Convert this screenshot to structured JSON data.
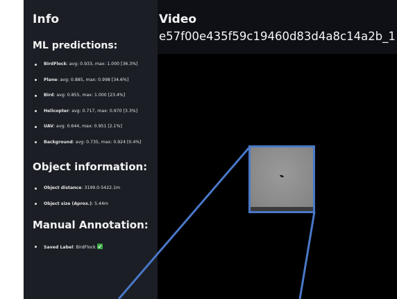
{
  "sidebar": {
    "title": "Info",
    "ml_section": {
      "title": "ML predictions:",
      "items": [
        {
          "name": "BirdFlock",
          "detail": ": avg: 0.933, max: 1.000 [36.3%]"
        },
        {
          "name": "Plane",
          "detail": ": avg: 0.885, max: 0.998 [34.6%]"
        },
        {
          "name": "Bird",
          "detail": ": avg: 0.855, max: 1.000 [23.4%]"
        },
        {
          "name": "Helicopter",
          "detail": ": avg: 0.717, max: 0.970 [3.3%]"
        },
        {
          "name": "UAV",
          "detail": ": avg: 0.644, max: 0.951 [2.1%]"
        },
        {
          "name": "Background",
          "detail": ": avg: 0.735, max: 0.924 [0.4%]"
        }
      ]
    },
    "object_section": {
      "title": "Object information:",
      "items": [
        {
          "name": "Object distance",
          "detail": ": 3199.0-5422.1m"
        },
        {
          "name": "Object size (Aprox.)",
          "detail": ": 5.44m"
        }
      ]
    },
    "manual_section": {
      "title": "Manual Annotation:",
      "items": [
        {
          "name": "Saved Label",
          "detail": ": BirdFlock",
          "icon": "checkmark-icon"
        }
      ]
    }
  },
  "main": {
    "title": "Video",
    "video_id": "e57f00e435f59c19460d83d4a8c14a2b_1"
  },
  "colors": {
    "sidebar_bg": "#1b1e25",
    "main_bg": "#0e1016",
    "zoom_border": "#4a78c8",
    "check_green": "#3aa845"
  }
}
